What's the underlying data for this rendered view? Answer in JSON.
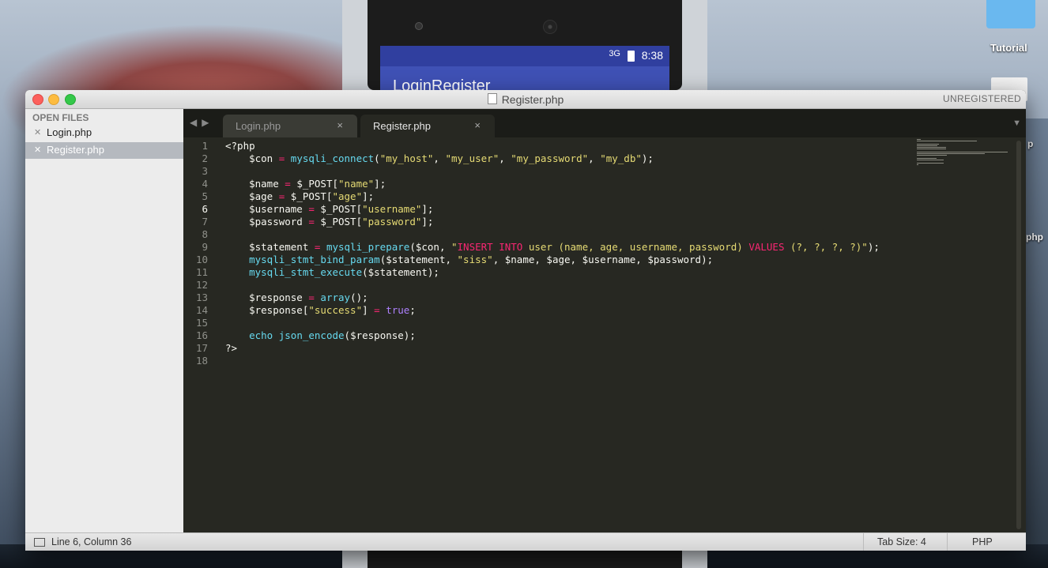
{
  "emulator": {
    "status_signal": "3G",
    "status_time": "8:38",
    "app_title": "LoginRegister"
  },
  "desktop": {
    "folder_label": "Tutorial",
    "partial_label_1": "p",
    "partial_label_2": "php"
  },
  "window": {
    "title": "Register.php",
    "unregistered": "UNREGISTERED"
  },
  "sidebar": {
    "heading": "OPEN FILES",
    "items": [
      {
        "label": "Login.php"
      },
      {
        "label": "Register.php"
      }
    ]
  },
  "tabs": [
    {
      "label": "Login.php",
      "close": "×"
    },
    {
      "label": "Register.php",
      "close": "×"
    }
  ],
  "editor": {
    "line_numbers": [
      "1",
      "2",
      "3",
      "4",
      "5",
      "6",
      "7",
      "8",
      "9",
      "10",
      "11",
      "12",
      "13",
      "14",
      "15",
      "16",
      "17",
      "18"
    ],
    "current_line": 6,
    "lines": [
      [
        {
          "t": "<?php",
          "c": "v"
        }
      ],
      [
        {
          "t": "    $con ",
          "c": "v"
        },
        {
          "t": "=",
          "c": "o"
        },
        {
          "t": " ",
          "c": "v"
        },
        {
          "t": "mysqli_connect",
          "c": "f"
        },
        {
          "t": "(",
          "c": "v"
        },
        {
          "t": "\"my_host\"",
          "c": "s"
        },
        {
          "t": ", ",
          "c": "v"
        },
        {
          "t": "\"my_user\"",
          "c": "s"
        },
        {
          "t": ", ",
          "c": "v"
        },
        {
          "t": "\"my_password\"",
          "c": "s"
        },
        {
          "t": ", ",
          "c": "v"
        },
        {
          "t": "\"my_db\"",
          "c": "s"
        },
        {
          "t": ");",
          "c": "v"
        }
      ],
      [],
      [
        {
          "t": "    $name ",
          "c": "v"
        },
        {
          "t": "=",
          "c": "o"
        },
        {
          "t": " $_POST[",
          "c": "v"
        },
        {
          "t": "\"name\"",
          "c": "s"
        },
        {
          "t": "];",
          "c": "v"
        }
      ],
      [
        {
          "t": "    $age ",
          "c": "v"
        },
        {
          "t": "=",
          "c": "o"
        },
        {
          "t": " $_POST[",
          "c": "v"
        },
        {
          "t": "\"age\"",
          "c": "s"
        },
        {
          "t": "];",
          "c": "v"
        }
      ],
      [
        {
          "t": "    $username ",
          "c": "v"
        },
        {
          "t": "=",
          "c": "o"
        },
        {
          "t": " $_POST[",
          "c": "v"
        },
        {
          "t": "\"username\"",
          "c": "s"
        },
        {
          "t": "];",
          "c": "v"
        }
      ],
      [
        {
          "t": "    $password ",
          "c": "v"
        },
        {
          "t": "=",
          "c": "o"
        },
        {
          "t": " $_POST[",
          "c": "v"
        },
        {
          "t": "\"password\"",
          "c": "s"
        },
        {
          "t": "];",
          "c": "v"
        }
      ],
      [],
      [
        {
          "t": "    $statement ",
          "c": "v"
        },
        {
          "t": "=",
          "c": "o"
        },
        {
          "t": " ",
          "c": "v"
        },
        {
          "t": "mysqli_prepare",
          "c": "f"
        },
        {
          "t": "($con, ",
          "c": "v"
        },
        {
          "t": "\"",
          "c": "s"
        },
        {
          "t": "INSERT INTO",
          "c": "k"
        },
        {
          "t": " user (name, age, username, password) ",
          "c": "s"
        },
        {
          "t": "VALUES",
          "c": "k"
        },
        {
          "t": " (?, ?, ?, ?)\"",
          "c": "s"
        },
        {
          "t": ");",
          "c": "v"
        }
      ],
      [
        {
          "t": "    ",
          "c": "v"
        },
        {
          "t": "mysqli_stmt_bind_param",
          "c": "f"
        },
        {
          "t": "($statement, ",
          "c": "v"
        },
        {
          "t": "\"siss\"",
          "c": "s"
        },
        {
          "t": ", $name, $age, $username, $password);",
          "c": "v"
        }
      ],
      [
        {
          "t": "    ",
          "c": "v"
        },
        {
          "t": "mysqli_stmt_execute",
          "c": "f"
        },
        {
          "t": "($statement);",
          "c": "v"
        }
      ],
      [],
      [
        {
          "t": "    $response ",
          "c": "v"
        },
        {
          "t": "=",
          "c": "o"
        },
        {
          "t": " ",
          "c": "v"
        },
        {
          "t": "array",
          "c": "f"
        },
        {
          "t": "();",
          "c": "v"
        }
      ],
      [
        {
          "t": "    $response[",
          "c": "v"
        },
        {
          "t": "\"success\"",
          "c": "s"
        },
        {
          "t": "] ",
          "c": "v"
        },
        {
          "t": "=",
          "c": "o"
        },
        {
          "t": " ",
          "c": "v"
        },
        {
          "t": "true",
          "c": "c"
        },
        {
          "t": ";",
          "c": "v"
        }
      ],
      [],
      [
        {
          "t": "    ",
          "c": "v"
        },
        {
          "t": "echo",
          "c": "f"
        },
        {
          "t": " ",
          "c": "v"
        },
        {
          "t": "json_encode",
          "c": "f"
        },
        {
          "t": "($response);",
          "c": "v"
        }
      ],
      [
        {
          "t": "?>",
          "c": "v"
        }
      ],
      []
    ]
  },
  "statusbar": {
    "position": "Line 6, Column 36",
    "tab_size": "Tab Size: 4",
    "syntax": "PHP"
  },
  "colors": {
    "editor_bg": "#272822",
    "keyword": "#f92672",
    "function": "#66d9ef",
    "string": "#e6db74",
    "constant": "#ae81ff"
  }
}
